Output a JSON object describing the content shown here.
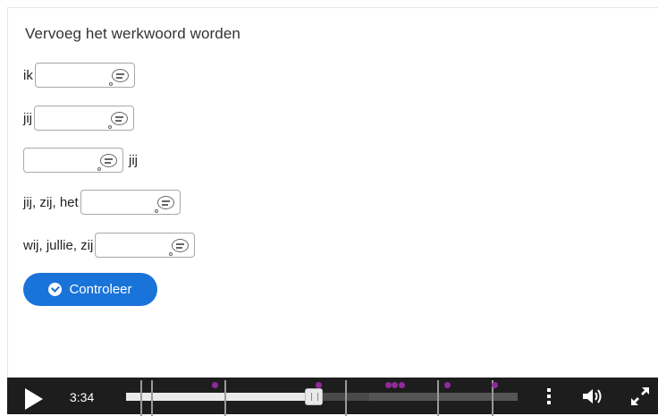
{
  "exercise": {
    "title": "Vervoeg het werkwoord worden",
    "rows": [
      {
        "before": "ik",
        "after": "",
        "value": ""
      },
      {
        "before": "jij",
        "after": "",
        "value": ""
      },
      {
        "before": "",
        "after": "jij",
        "value": ""
      },
      {
        "before": "jij, zij, het",
        "after": "",
        "value": ""
      },
      {
        "before": "wij, jullie, zij",
        "after": "",
        "value": ""
      }
    ],
    "check_label": "Controleer"
  },
  "player": {
    "time": "3:34",
    "progress": 0.48,
    "buffered_end": 0.62,
    "accent_color": "#8f2a9b",
    "button_color": "#1a73d9"
  },
  "icons": {
    "tip": "speech-bubble-icon",
    "check": "check-circle-icon",
    "play": "play-icon",
    "menu": "more-vert-icon",
    "volume": "volume-icon",
    "fullscreen": "fullscreen-icon"
  }
}
